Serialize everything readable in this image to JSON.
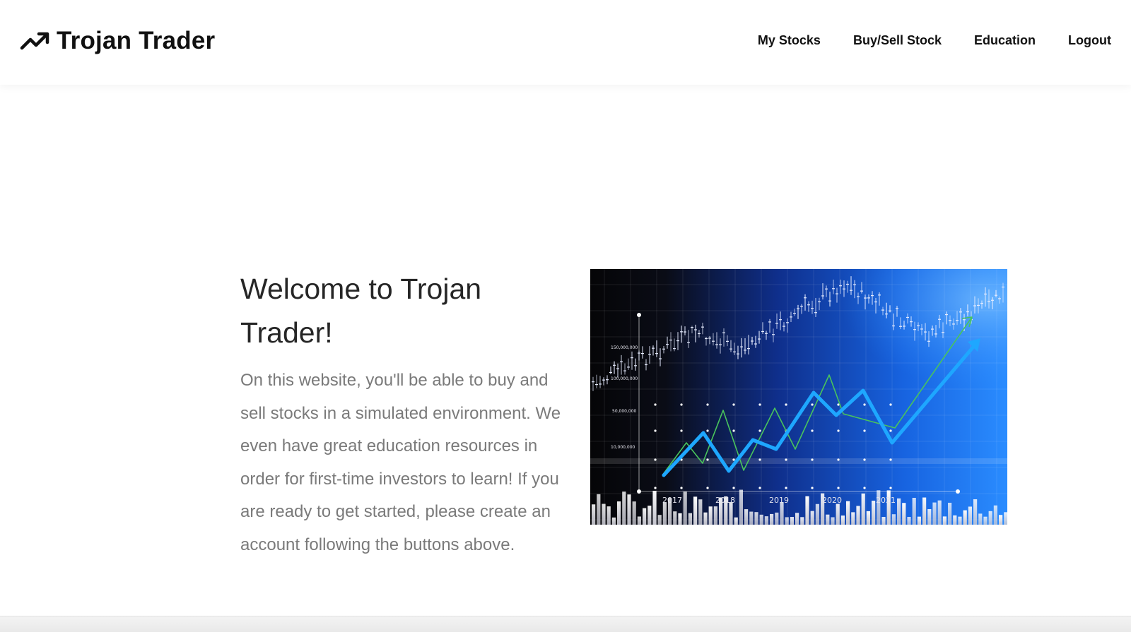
{
  "brand": {
    "name": "Trojan Trader",
    "icon": "trending-up-icon"
  },
  "nav": {
    "my_stocks": "My Stocks",
    "buy_sell": "Buy/Sell Stock",
    "education": "Education",
    "logout": "Logout"
  },
  "hero": {
    "title": "Welcome to Trojan Trader!",
    "body": "On this website, you'll be able to buy and sell stocks in a simulated environment. We even have great education resources in order for first-time investors to learn! If you are ready to get started, please create an account following the buttons above.",
    "image": {
      "description_icon": "stock-chart-illustration",
      "axis_labels": [
        "150,000,000",
        "100,000,000",
        "50,000,000",
        "10,000,000"
      ],
      "years": [
        "2017",
        "2018",
        "2019",
        "2020",
        "2021"
      ]
    }
  },
  "colors": {
    "accent_blue": "#1e8fff",
    "title_text": "#262626",
    "body_text": "#7a7a7a"
  }
}
